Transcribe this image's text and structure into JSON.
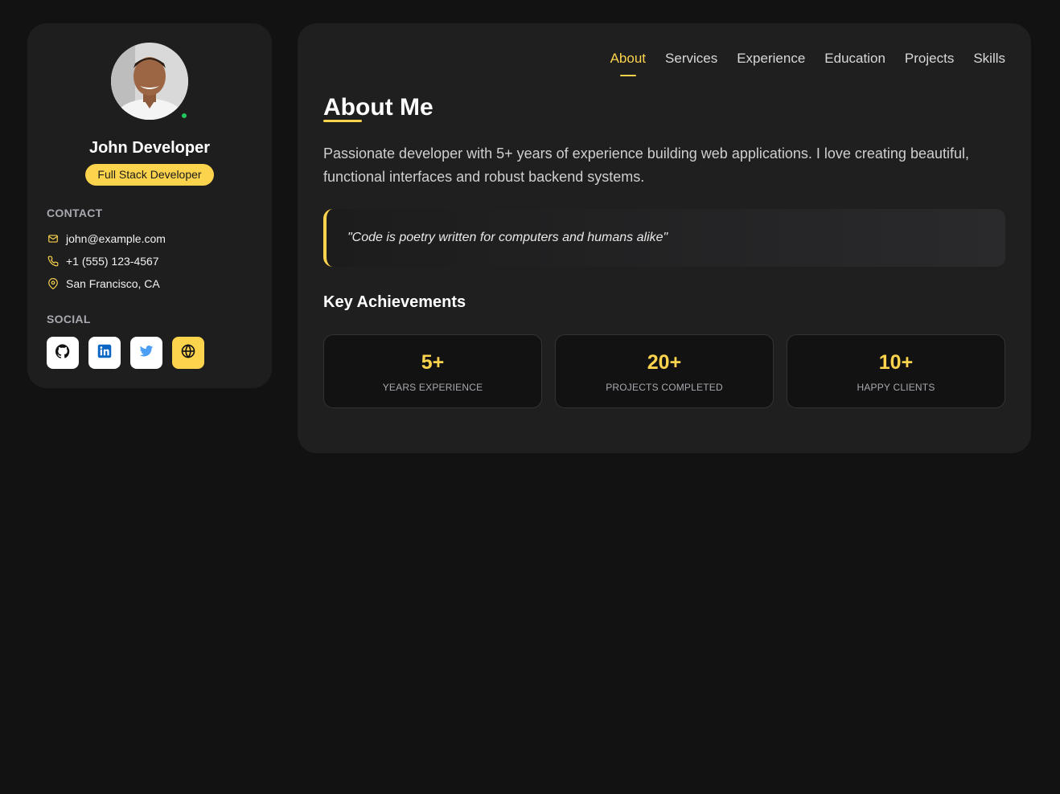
{
  "profile": {
    "name": "John Developer",
    "role": "Full Stack Developer"
  },
  "contact": {
    "title": "CONTACT",
    "email": "john@example.com",
    "phone": "+1 (555) 123-4567",
    "location": "San Francisco, CA"
  },
  "social": {
    "title": "SOCIAL",
    "items": [
      {
        "icon": "github-icon",
        "color": "#111111"
      },
      {
        "icon": "linkedin-icon",
        "color": "#0a66c2"
      },
      {
        "icon": "twitter-icon",
        "color": "#1da1f2"
      },
      {
        "icon": "globe-icon",
        "color": "#111111"
      }
    ]
  },
  "nav": {
    "items": [
      "About",
      "Services",
      "Experience",
      "Education",
      "Projects",
      "Skills"
    ],
    "active": "About"
  },
  "about": {
    "title": "About Me",
    "text": "Passionate developer with 5+ years of experience building web applications. I love creating beautiful, functional interfaces and robust backend systems.",
    "quote": "\"Code is poetry written for computers and humans alike\""
  },
  "achievements": {
    "title": "Key Achievements",
    "items": [
      {
        "value": "5+",
        "label": "YEARS EXPERIENCE"
      },
      {
        "value": "20+",
        "label": "PROJECTS COMPLETED"
      },
      {
        "value": "10+",
        "label": "HAPPY CLIENTS"
      }
    ]
  },
  "colors": {
    "accent": "#fcd34d",
    "background": "#121212",
    "panel": "#1e1e1e",
    "online": "#22c55e"
  }
}
